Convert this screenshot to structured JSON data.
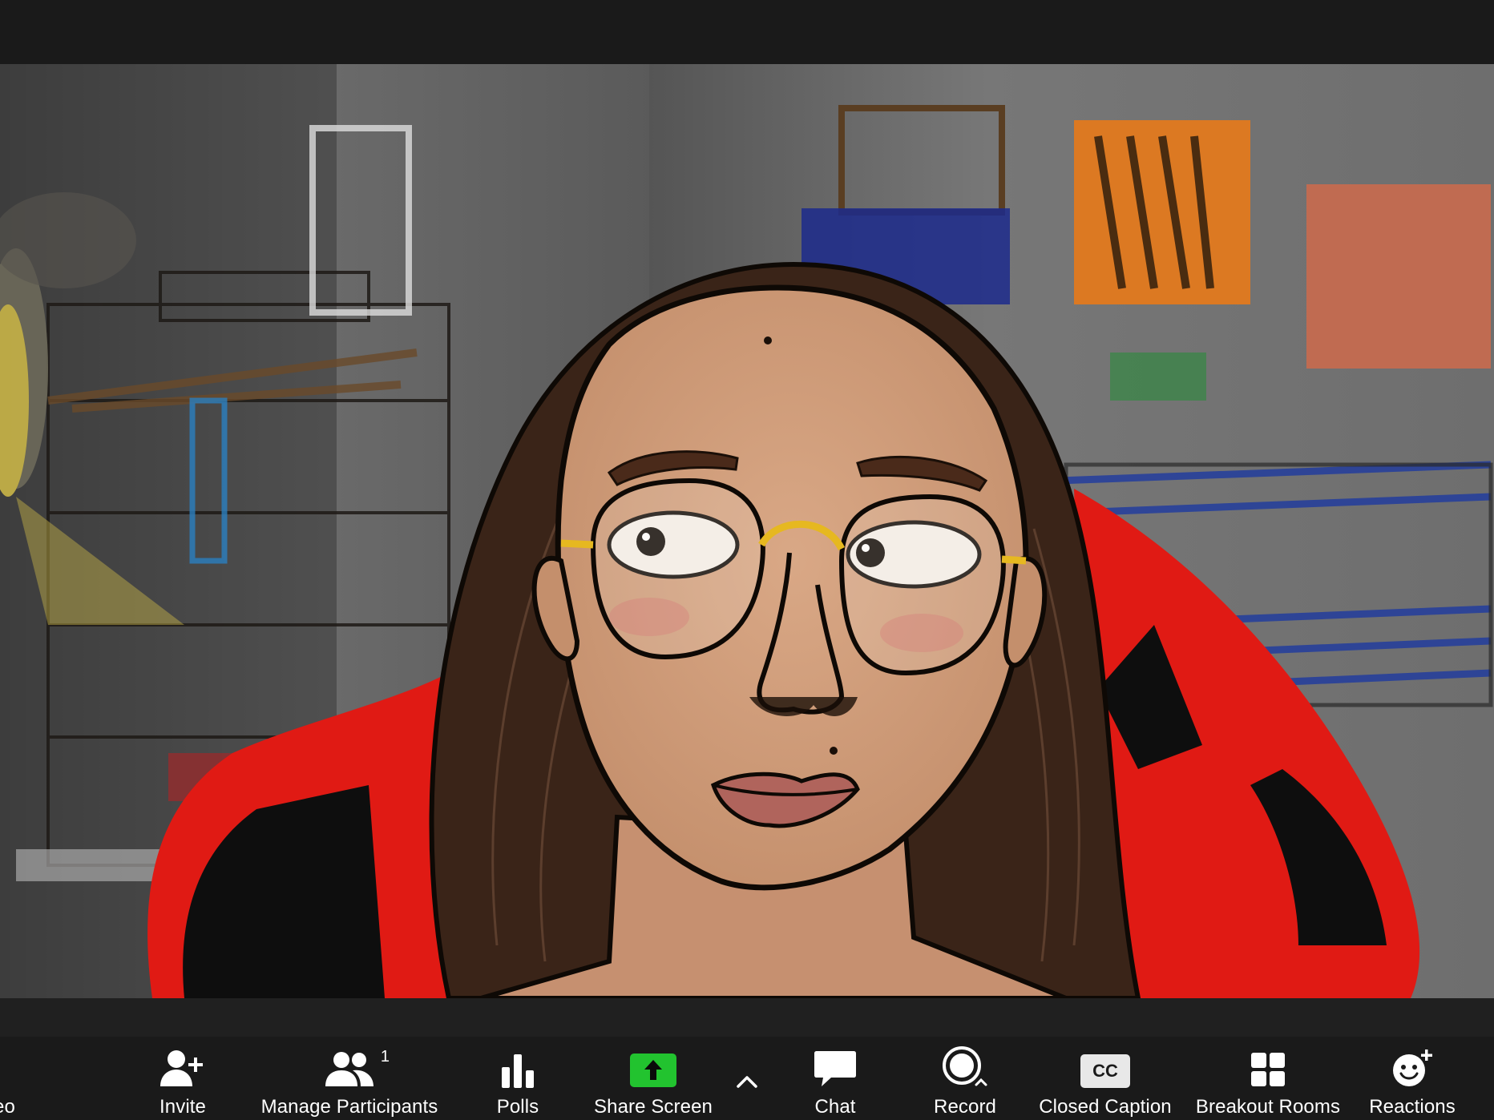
{
  "toolbar": {
    "cut_label": "eo",
    "invite_label": "Invite",
    "manage_participants_label": "Manage Participants",
    "participant_count": "1",
    "polls_label": "Polls",
    "share_screen_label": "Share Screen",
    "chat_label": "Chat",
    "record_label": "Record",
    "closed_caption_label": "Closed Caption",
    "cc_glyph": "CC",
    "breakout_rooms_label": "Breakout Rooms",
    "reactions_label": "Reactions"
  },
  "icons": {
    "invite": "invite-person-plus-icon",
    "participants": "participants-icon",
    "polls": "bar-chart-icon",
    "share": "share-screen-arrow-icon",
    "caret": "chevron-up-icon",
    "chat": "chat-bubble-icon",
    "record": "record-icon",
    "cc": "closed-caption-icon",
    "breakout": "grid-icon",
    "reactions": "smiley-plus-icon"
  },
  "colors": {
    "toolbar_bg": "#1a1a1a",
    "share_green": "#22c32f",
    "icon_white": "#ffffff",
    "chair_red": "#e01a14"
  }
}
